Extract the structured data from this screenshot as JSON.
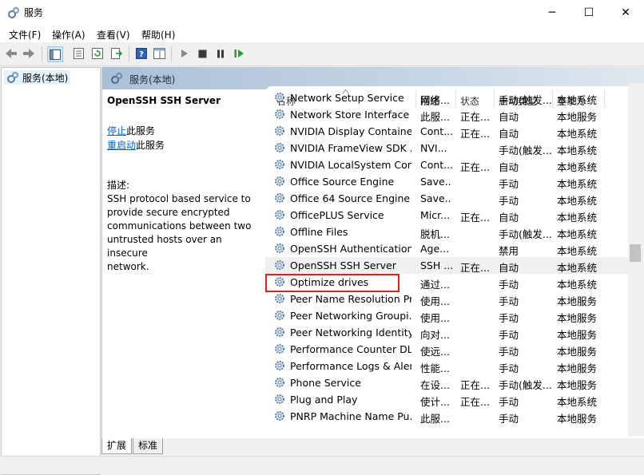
{
  "window": {
    "title": "服务",
    "minimize": "─",
    "maximize": "☐",
    "close": "✕"
  },
  "menu": [
    "文件(F)",
    "操作(A)",
    "查看(V)",
    "帮助(H)"
  ],
  "toolbar": {
    "icons": [
      "back-icon",
      "forward-icon",
      "console-tree-icon",
      "properties-icon",
      "refresh-icon",
      "export-icon",
      "help-icon",
      "show-hide-icon",
      "start-icon",
      "stop-icon",
      "pause-icon",
      "restart-icon"
    ]
  },
  "tree": {
    "item": "服务(本地)"
  },
  "panel": {
    "header": "服务(本地)",
    "service_name": "OpenSSH SSH Server",
    "stop_link": "停止",
    "stop_suffix": "此服务",
    "restart_link": "重启动",
    "restart_suffix": "此服务",
    "desc_label": "描述:",
    "desc_lines": [
      "SSH protocol based service to",
      "provide secure encrypted",
      "communications between two",
      "untrusted hosts over an insecure",
      "network."
    ]
  },
  "columns": {
    "name": "名称",
    "desc": "描述",
    "status": "状态",
    "start_type": "启动类型",
    "logon": "登录为"
  },
  "rows": [
    {
      "name": "Network Setup Service",
      "desc": "网络...",
      "status": "",
      "start": "手动(触发...",
      "logon": "本地系统"
    },
    {
      "name": "Network Store Interface ...",
      "desc": "此服...",
      "status": "正在...",
      "start": "自动",
      "logon": "本地服务"
    },
    {
      "name": "NVIDIA Display Containe...",
      "desc": "Cont...",
      "status": "正在...",
      "start": "自动",
      "logon": "本地系统"
    },
    {
      "name": "NVIDIA FrameView SDK ...",
      "desc": "NVI...",
      "status": "",
      "start": "手动(触发...",
      "logon": "本地系统"
    },
    {
      "name": "NVIDIA LocalSystem Con...",
      "desc": "Cont...",
      "status": "正在...",
      "start": "自动",
      "logon": "本地系统"
    },
    {
      "name": "Office  Source Engine",
      "desc": "Save...",
      "status": "",
      "start": "手动",
      "logon": "本地系统"
    },
    {
      "name": "Office 64 Source Engine",
      "desc": "Save...",
      "status": "",
      "start": "手动",
      "logon": "本地系统"
    },
    {
      "name": "OfficePLUS Service",
      "desc": "Micr...",
      "status": "正在...",
      "start": "自动",
      "logon": "本地系统"
    },
    {
      "name": "Offline Files",
      "desc": "脱机...",
      "status": "",
      "start": "手动(触发...",
      "logon": "本地系统"
    },
    {
      "name": "OpenSSH Authentication ...",
      "desc": "Age...",
      "status": "",
      "start": "禁用",
      "logon": "本地系统"
    },
    {
      "name": "OpenSSH SSH Server",
      "desc": "SSH ...",
      "status": "正在...",
      "start": "自动",
      "logon": "本地系统"
    },
    {
      "name": "Optimize drives",
      "desc": "通过...",
      "status": "",
      "start": "手动",
      "logon": "本地系统"
    },
    {
      "name": "Peer Name Resolution Pr...",
      "desc": "使用...",
      "status": "",
      "start": "手动",
      "logon": "本地服务"
    },
    {
      "name": "Peer Networking Groupi...",
      "desc": "使用...",
      "status": "",
      "start": "手动",
      "logon": "本地服务"
    },
    {
      "name": "Peer Networking Identity...",
      "desc": "向对...",
      "status": "",
      "start": "手动",
      "logon": "本地服务"
    },
    {
      "name": "Performance Counter DL...",
      "desc": "使远...",
      "status": "",
      "start": "手动",
      "logon": "本地服务"
    },
    {
      "name": "Performance Logs & Aler...",
      "desc": "性能...",
      "status": "",
      "start": "手动",
      "logon": "本地服务"
    },
    {
      "name": "Phone Service",
      "desc": "在设...",
      "status": "正在...",
      "start": "手动(触发...",
      "logon": "本地服务"
    },
    {
      "name": "Plug and Play",
      "desc": "使计...",
      "status": "正在...",
      "start": "手动",
      "logon": "本地系统"
    },
    {
      "name": "PNRP Machine Name Pu...",
      "desc": "此服...",
      "status": "",
      "start": "手动",
      "logon": "本地服务"
    }
  ],
  "tabs": [
    "扩展",
    "标准"
  ],
  "colors": {
    "highlight_border": "#e0201c",
    "link": "#0563c1",
    "selected_row": "#f0f0f0"
  }
}
